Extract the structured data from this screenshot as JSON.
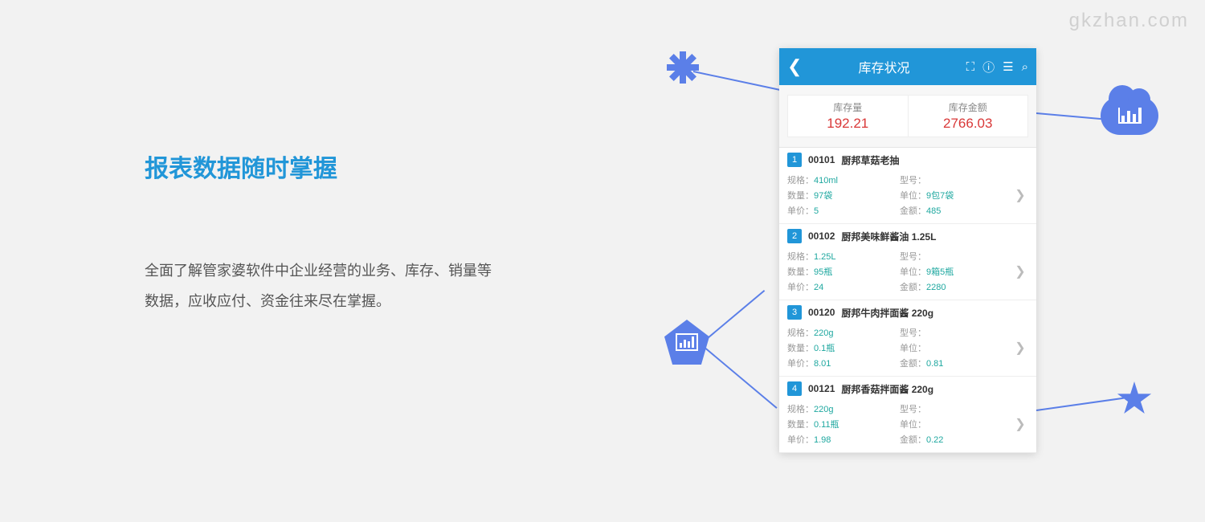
{
  "watermark": "gkzhan.com",
  "left": {
    "heading": "报表数据随时掌握",
    "description": "全面了解管家婆软件中企业经营的业务、库存、销量等数据，应收应付、资金往来尽在掌握。"
  },
  "phone": {
    "header": {
      "title": "库存状况",
      "icons": {
        "scan": "scan-icon",
        "info": "info-icon",
        "list": "list-icon",
        "search": "search-icon"
      }
    },
    "summary": {
      "qty_label": "库存量",
      "qty_value": "192.21",
      "amount_label": "库存金额",
      "amount_value": "2766.03"
    },
    "labels": {
      "spec": "规格：",
      "model": "型号：",
      "qty": "数量：",
      "unit": "单位：",
      "price": "单价：",
      "amount": "金额："
    },
    "items": [
      {
        "num": "1",
        "code": "00101",
        "name": "厨邦草菇老抽",
        "spec": "410ml",
        "model": "",
        "qty": "97袋",
        "unit": "9包7袋",
        "price": "5",
        "amount": "485"
      },
      {
        "num": "2",
        "code": "00102",
        "name": "厨邦美味鲜酱油 1.25L",
        "spec": "1.25L",
        "model": "",
        "qty": "95瓶",
        "unit": "9箱5瓶",
        "price": "24",
        "amount": "2280"
      },
      {
        "num": "3",
        "code": "00120",
        "name": "厨邦牛肉拌面酱 220g",
        "spec": "220g",
        "model": "",
        "qty": "0.1瓶",
        "unit": "",
        "price": "8.01",
        "amount": "0.81"
      },
      {
        "num": "4",
        "code": "00121",
        "name": "厨邦香菇拌面酱 220g",
        "spec": "220g",
        "model": "",
        "qty": "0.11瓶",
        "unit": "",
        "price": "1.98",
        "amount": "0.22"
      }
    ]
  }
}
